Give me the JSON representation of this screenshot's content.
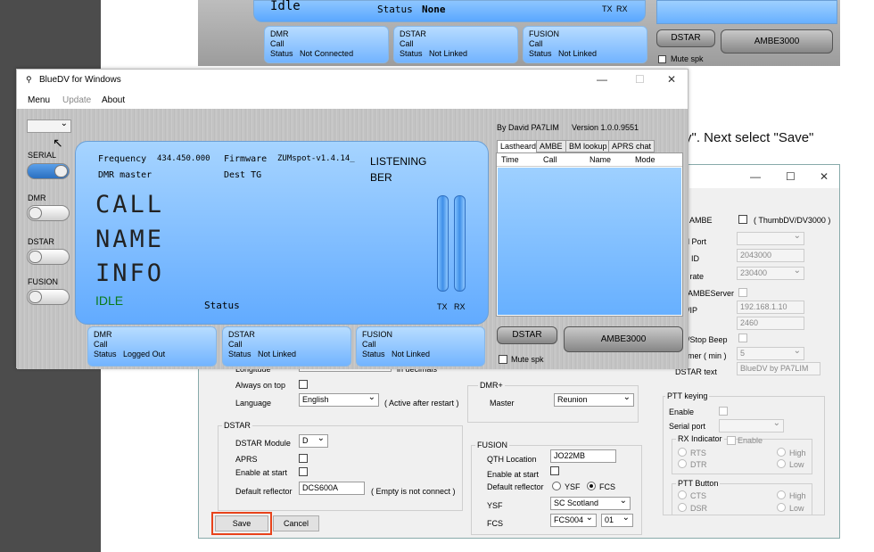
{
  "doc_text": "y\". Next select \"Save\"",
  "bg_window": {
    "status_mode": "Idle",
    "status_label": "Status",
    "status_value": "None",
    "tx": "TX",
    "rx": "RX",
    "panels": [
      {
        "title": "DMR",
        "call": "Call",
        "status_label": "Status",
        "status": "Not Connected"
      },
      {
        "title": "DSTAR",
        "call": "Call",
        "status_label": "Status",
        "status": "Not Linked"
      },
      {
        "title": "FUSION",
        "call": "Call",
        "status_label": "Status",
        "status": "Not Linked"
      }
    ],
    "dstar_btn": "DSTAR",
    "ambe_btn": "AMBE3000",
    "mute": "Mute spk"
  },
  "settings": {
    "ambe_label": "AMBE",
    "ambe_hint": "( ThumbDV/DV3000 )",
    "serial_port_label": "al Port",
    "id_label": "R ID",
    "id_value": "2043000",
    "baud_label": "d rate",
    "baud_value": "230400",
    "ambeserver_label": "AMBEServer",
    "ip_label": "/IP",
    "ip_value": "192.168.1.10",
    "port_value": "2460",
    "beep_label": "/Stop Beep",
    "timer_label": "mer ( min )",
    "timer_value": "5",
    "dstar_text_label": "DSTAR text",
    "dstar_text_value": "BlueDV by PA7LIM",
    "longitude_label": "Longitude",
    "decimals": "in decimals",
    "always_on_top": "Always on top",
    "language_label": "Language",
    "language_value": "English",
    "language_note": "( Active after restart )",
    "dstar_group": "DSTAR",
    "dstar_module_label": "DSTAR Module",
    "dstar_module_value": "D",
    "aprs_label": "APRS",
    "enable_start_label": "Enable at start",
    "default_reflector_label": "Default reflector",
    "default_reflector_value": "DCS600A",
    "reflector_note": "( Empty is not connect )",
    "dmr_group": "DMR+",
    "master_label": "Master",
    "master_value": "Reunion",
    "fusion_group": "FUSION",
    "qth_label": "QTH Location",
    "qth_value": "JO22MB",
    "fusion_enable_label": "Enable at start",
    "fusion_default_label": "Default reflector",
    "ysf_radio": "YSF",
    "fcs_radio": "FCS",
    "ysf_label": "YSF",
    "ysf_value": "SC Scotland",
    "fcs_label": "FCS",
    "fcs_value": "FCS004",
    "fcs_num": "01",
    "ptt_group": "PTT keying",
    "ptt_enable": "Enable",
    "serial_port2": "Serial port",
    "rx_indicator": "RX Indicator",
    "rx_enable": "Enable",
    "rts": "RTS",
    "dtr": "DTR",
    "high": "High",
    "low": "Low",
    "ptt_button": "PTT Button",
    "cts": "CTS",
    "dsr": "DSR",
    "high2": "High",
    "low2": "Low",
    "save": "Save",
    "cancel": "Cancel"
  },
  "bluedv": {
    "title": "BlueDV for Windows",
    "menu": [
      "Menu",
      "Update",
      "About"
    ],
    "author": "By David PA7LIM",
    "version": "Version 1.0.0.9551",
    "modes": [
      "SERIAL",
      "DMR",
      "DSTAR",
      "FUSION"
    ],
    "lcd": {
      "freq_label": "Frequency",
      "freq_value": "434.450.000",
      "fw_label": "Firmware",
      "fw_value": "ZUMspot-v1.4.14_",
      "dmr_master": "DMR master",
      "dest_tg": "Dest TG",
      "listening": "LISTENING",
      "ber": "BER",
      "call": "CALL",
      "name": "NAME",
      "info": "INFO",
      "idle": "IDLE",
      "status": "Status",
      "tx": "TX",
      "rx": "RX"
    },
    "tabs": [
      "Lastheard",
      "AMBE",
      "BM lookup",
      "APRS chat"
    ],
    "columns": [
      "Time",
      "Call",
      "Name",
      "Mode"
    ],
    "panels": [
      {
        "title": "DMR",
        "call": "Call",
        "status_label": "Status",
        "status": "Logged Out"
      },
      {
        "title": "DSTAR",
        "call": "Call",
        "status_label": "Status",
        "status": "Not Linked"
      },
      {
        "title": "FUSION",
        "call": "Call",
        "status_label": "Status",
        "status": "Not Linked"
      }
    ],
    "dstar_btn": "DSTAR",
    "ambe_btn": "AMBE3000",
    "mute": "Mute spk"
  }
}
